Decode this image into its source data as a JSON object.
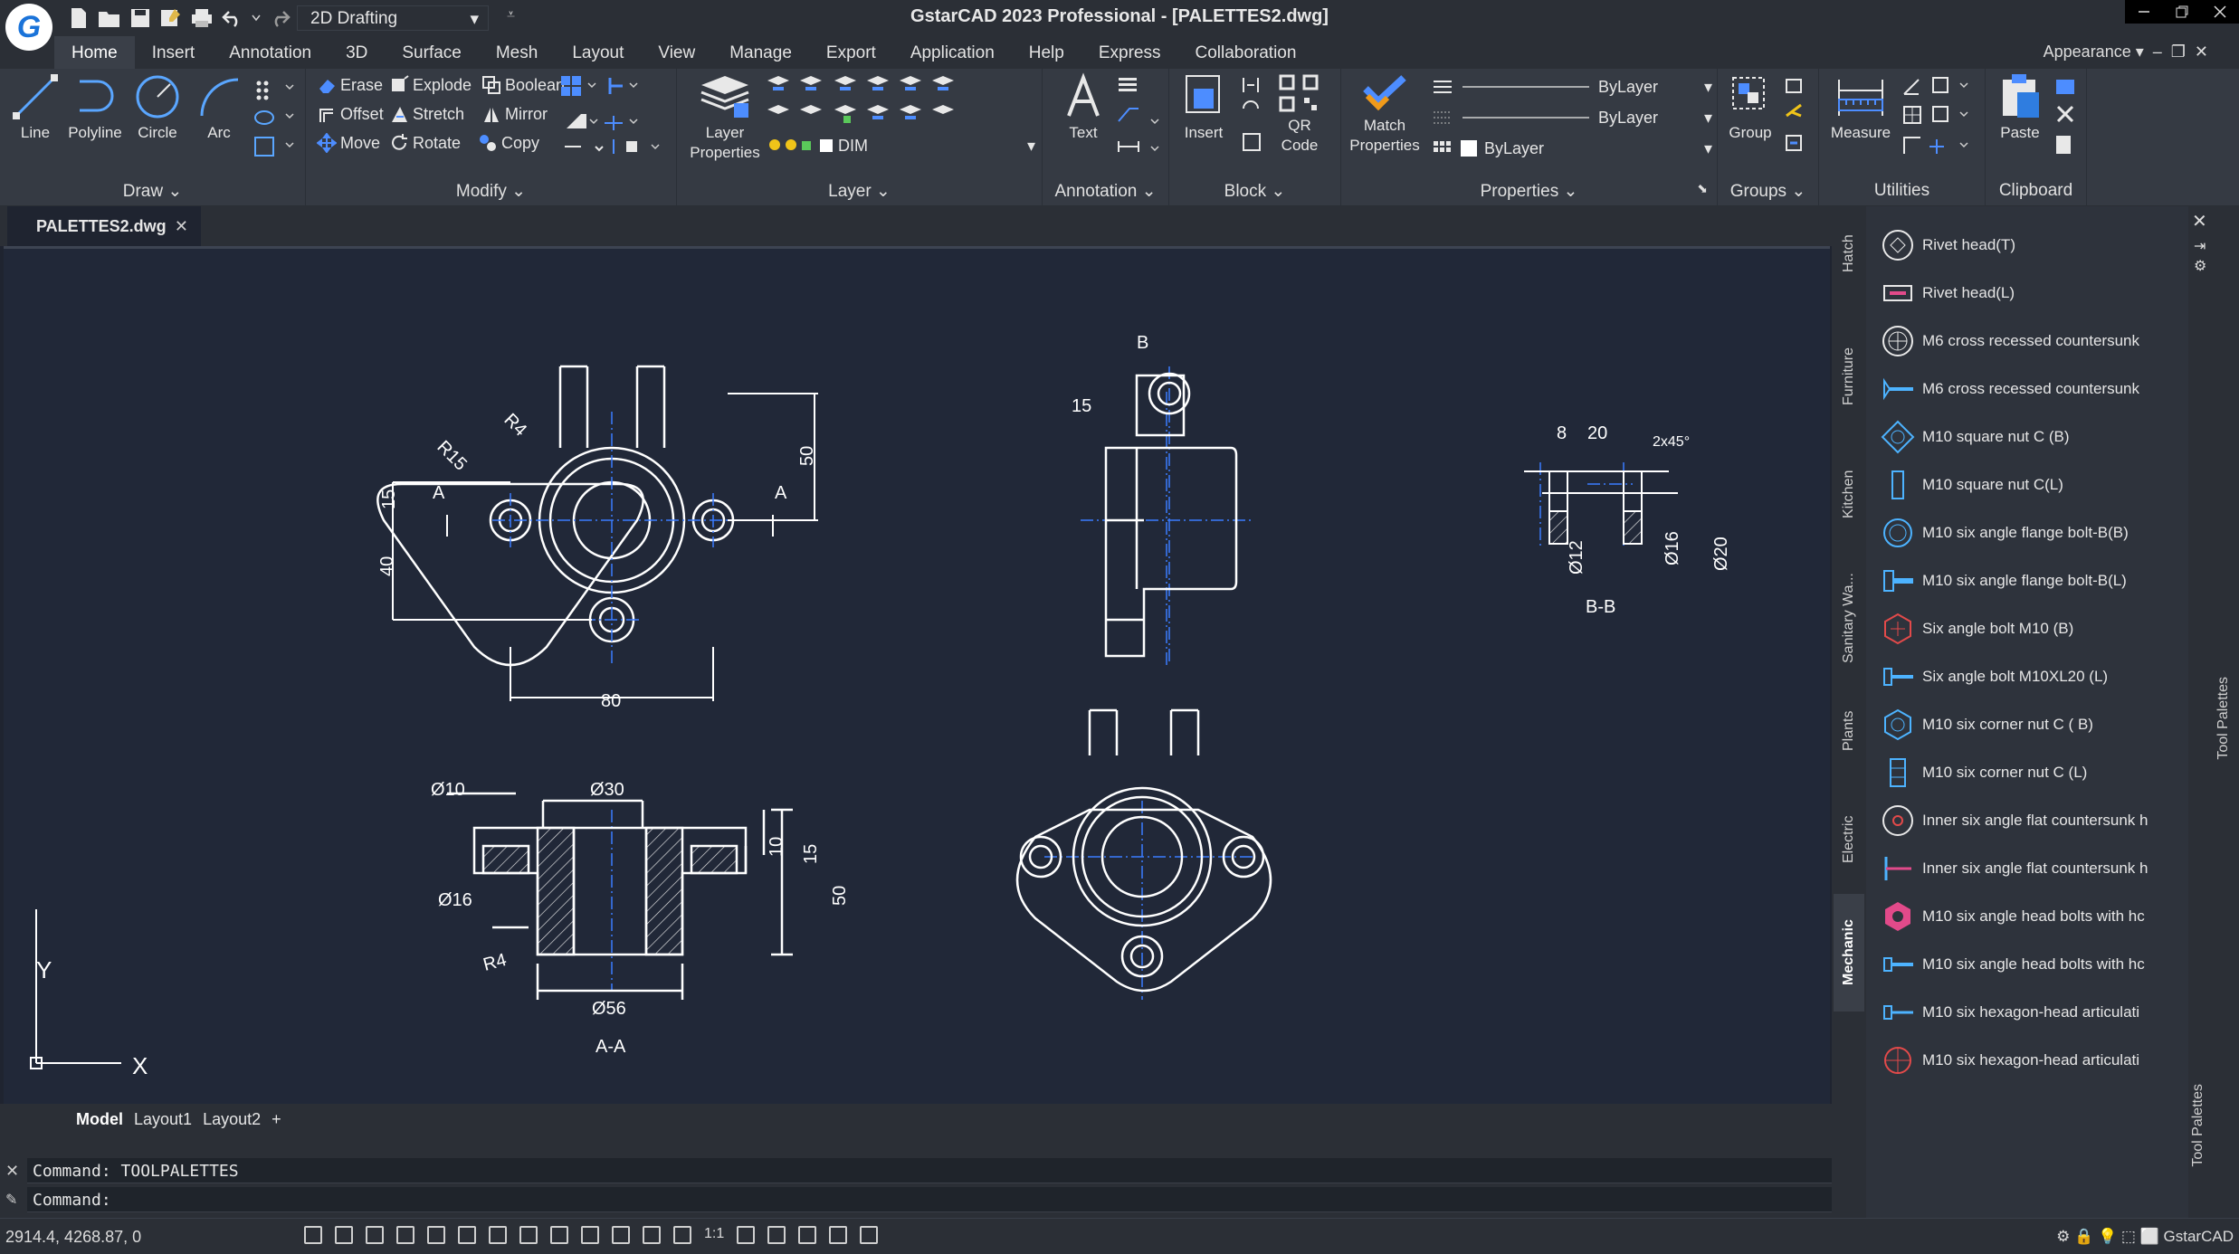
{
  "window": {
    "title": "GstarCAD 2023 Professional - [PALETTES2.dwg]",
    "workspace": "2D Drafting",
    "appearance": "Appearance"
  },
  "menu": [
    "Home",
    "Insert",
    "Annotation",
    "3D",
    "Surface",
    "Mesh",
    "Layout",
    "View",
    "Manage",
    "Export",
    "Application",
    "Help",
    "Express",
    "Collaboration"
  ],
  "ribbon": {
    "draw": {
      "title": "Draw",
      "line": "Line",
      "polyline": "Polyline",
      "circle": "Circle",
      "arc": "Arc"
    },
    "modify": {
      "title": "Modify",
      "erase": "Erase",
      "explode": "Explode",
      "boolean": "Boolean",
      "offset": "Offset",
      "stretch": "Stretch",
      "mirror": "Mirror",
      "move": "Move",
      "rotate": "Rotate",
      "copy": "Copy"
    },
    "layer": {
      "title": "Layer",
      "layer_properties_1": "Layer",
      "layer_properties_2": "Properties",
      "current_layer": "DIM"
    },
    "annotation": {
      "title": "Annotation",
      "text": "Text"
    },
    "block": {
      "title": "Block",
      "insert": "Insert",
      "qr_1": "QR",
      "qr_2": "Code"
    },
    "properties": {
      "title": "Properties",
      "match_1": "Match",
      "match_2": "Properties",
      "color": "ByLayer",
      "linetype": "ByLayer",
      "lineweight": "ByLayer"
    },
    "groups": {
      "title": "Groups",
      "group": "Group"
    },
    "utilities": {
      "title": "Utilities",
      "measure": "Measure"
    },
    "clipboard": {
      "title": "Clipboard",
      "paste": "Paste"
    }
  },
  "file_tab": "PALETTES2.dwg",
  "drawing": {
    "dims": {
      "r4": "R4",
      "r15": "R15",
      "d15": "15",
      "d40": "40",
      "d80": "80",
      "d50": "50",
      "a": "A",
      "b": "B",
      "d15b": "15",
      "d8": "8",
      "d20": "20",
      "chamfer": "2x45°",
      "o12": "Ø12",
      "o16": "Ø16",
      "o20": "Ø20",
      "bb": "B-B",
      "o10": "Ø10",
      "o30": "Ø30",
      "o16b": "Ø16",
      "r4b": "R4",
      "o56": "Ø56",
      "d10": "10",
      "d15c": "15",
      "d50b": "50",
      "aa": "A-A"
    },
    "ucs_x": "X",
    "ucs_y": "Y"
  },
  "layout_tabs": [
    "Model",
    "Layout1",
    "Layout2",
    "+"
  ],
  "command": {
    "history": "Command: TOOLPALETTES",
    "prompt": "Command:"
  },
  "status": {
    "coords": "2914.4, 4268.87, 0",
    "scale": "1:1",
    "app": "GstarCAD"
  },
  "palette_tabs": [
    "Hatch",
    "Furniture",
    "Kitchen",
    "Sanitary Wa...",
    "Plants",
    "Electric",
    "Mechanic"
  ],
  "palette_items": [
    {
      "label": "Rivet head(T)",
      "icon": "rivet-top-icon"
    },
    {
      "label": "Rivet head(L)",
      "icon": "rivet-side-icon"
    },
    {
      "label": "M6 cross recessed countersunk",
      "icon": "cross-screw-top-icon"
    },
    {
      "label": "M6 cross recessed countersunk",
      "icon": "cross-screw-side-icon"
    },
    {
      "label": "M10 square nut C (B)",
      "icon": "square-nut-top-icon"
    },
    {
      "label": "M10 square nut C(L)",
      "icon": "square-nut-side-icon"
    },
    {
      "label": "M10 six angle flange bolt-B(B)",
      "icon": "flange-bolt-top-icon"
    },
    {
      "label": "M10 six angle flange bolt-B(L)",
      "icon": "flange-bolt-side-icon"
    },
    {
      "label": "Six angle bolt M10 (B)",
      "icon": "hex-bolt-top-icon"
    },
    {
      "label": "Six angle bolt M10XL20 (L)",
      "icon": "hex-bolt-side-icon"
    },
    {
      "label": "M10 six corner nut C ( B)",
      "icon": "hex-nut-top-icon"
    },
    {
      "label": "M10 six corner nut C (L)",
      "icon": "hex-nut-side-icon"
    },
    {
      "label": "Inner six angle flat countersunk h",
      "icon": "socket-screw-top-icon"
    },
    {
      "label": "Inner six angle flat countersunk h",
      "icon": "socket-screw-side-icon"
    },
    {
      "label": "M10 six angle head bolts with hc",
      "icon": "hole-bolt-top-icon"
    },
    {
      "label": "M10 six angle head bolts with hc",
      "icon": "hole-bolt-side-icon"
    },
    {
      "label": "M10 six hexagon-head articulati",
      "icon": "articulated-bolt-side-icon"
    },
    {
      "label": "M10 six hexagon-head articulati",
      "icon": "articulated-bolt-top-icon"
    }
  ],
  "palette_title": "Tool Palettes"
}
